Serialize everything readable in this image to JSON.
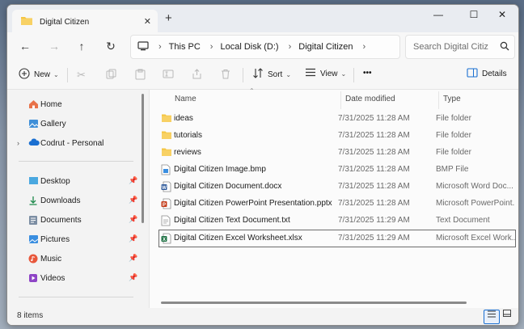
{
  "window": {
    "tab_title": "Digital Citizen",
    "tab_close": "✕",
    "new_tab": "+",
    "minimize": "—",
    "maximize": "☐",
    "close": "✕"
  },
  "nav": {
    "back": "←",
    "forward": "→",
    "up": "↑",
    "refresh": "↻"
  },
  "address": {
    "breadcrumbs": [
      "This PC",
      "Local Disk (D:)",
      "Digital Citizen"
    ],
    "separator": "›"
  },
  "search": {
    "placeholder": "Search Digital Citiz"
  },
  "toolbar": {
    "new_label": "New",
    "sort_label": "Sort",
    "view_label": "View",
    "more_label": "•••",
    "details_label": "Details"
  },
  "sidebar": {
    "home": "Home",
    "gallery": "Gallery",
    "onedrive": "Codrut - Personal",
    "desktop": "Desktop",
    "downloads": "Downloads",
    "documents": "Documents",
    "pictures": "Pictures",
    "music": "Music",
    "videos": "Videos"
  },
  "columns": {
    "name": "Name",
    "date": "Date modified",
    "type": "Type"
  },
  "files": [
    {
      "name": "ideas",
      "date": "7/31/2025 11:28 AM",
      "type": "File folder"
    },
    {
      "name": "tutorials",
      "date": "7/31/2025 11:28 AM",
      "type": "File folder"
    },
    {
      "name": "reviews",
      "date": "7/31/2025 11:28 AM",
      "type": "File folder"
    },
    {
      "name": "Digital Citizen Image.bmp",
      "date": "7/31/2025 11:28 AM",
      "type": "BMP File"
    },
    {
      "name": "Digital Citizen Document.docx",
      "date": "7/31/2025 11:28 AM",
      "type": "Microsoft Word Doc..."
    },
    {
      "name": "Digital Citizen  PowerPoint Presentation.pptx",
      "date": "7/31/2025 11:28 AM",
      "type": "Microsoft PowerPoint..."
    },
    {
      "name": "Digital Citizen Text Document.txt",
      "date": "7/31/2025 11:29 AM",
      "type": "Text Document"
    },
    {
      "name": "Digital Citizen  Excel Worksheet.xlsx",
      "date": "7/31/2025 11:29 AM",
      "type": "Microsoft Excel Work..."
    }
  ],
  "status": {
    "count": "8 items"
  },
  "colors": {
    "folder": "#f5c542",
    "word": "#2b579a",
    "powerpoint": "#c43e1c",
    "excel": "#217346",
    "accent": "#1a6fd1"
  }
}
